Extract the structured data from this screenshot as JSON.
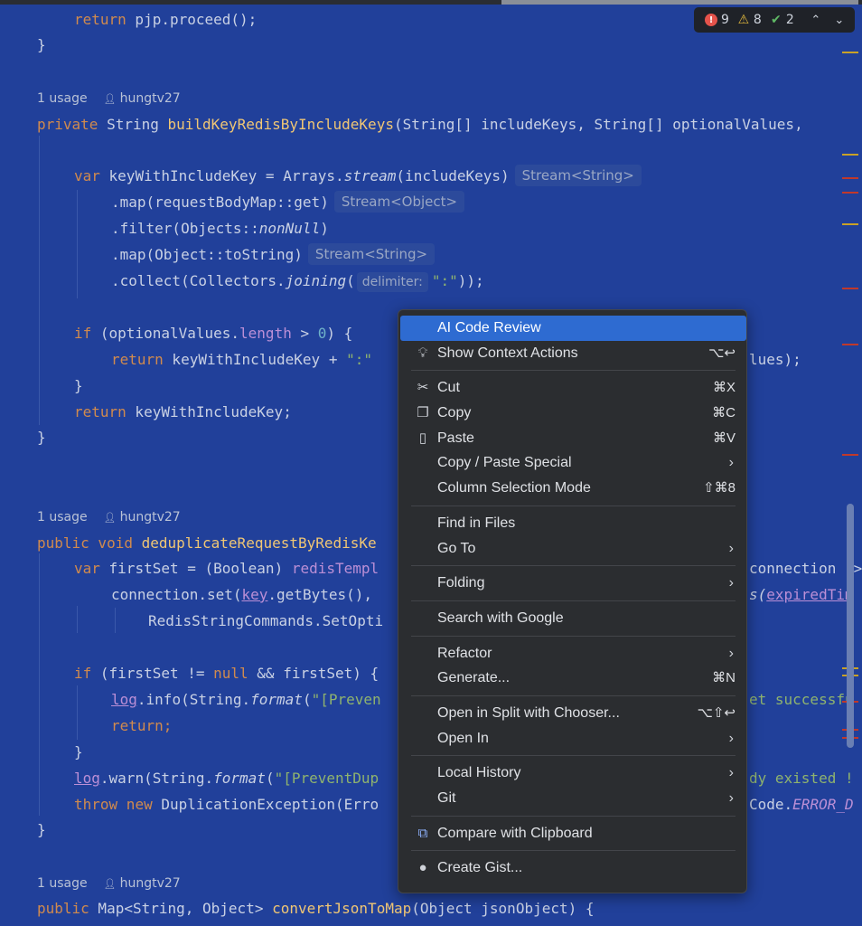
{
  "editor": {
    "lines": {
      "l_return_proceed_kw": "return",
      "l_return_proceed_rest": " pjp.proceed();",
      "close_brace": "}",
      "meta1_usage": "1 usage",
      "meta1_author": "hungtv27",
      "sig1_private": "private",
      "sig1_type": " String ",
      "sig1_name": "buildKeyRedisByIncludeKeys",
      "sig1_params": "(String[] includeKeys, String[] optionalValues, ",
      "var_kw": "var",
      "var_line_rest": " keyWithIncludeKey = Arrays.",
      "var_stream": "stream",
      "var_args": "(includeKeys)",
      "hint_stream_string": "Stream<String>",
      "map_get": ".map(requestBodyMap::get)",
      "hint_stream_object": "Stream<Object>",
      "filter_a": ".filter(Objects::",
      "filter_b": "nonNull",
      "filter_c": ")",
      "map_tostring": ".map(Object::toString)",
      "collect_a": ".collect(Collectors.",
      "collect_b": "joining",
      "collect_c": "(",
      "hint_delimiter": "delimiter:",
      "collect_str": "\":\"",
      "collect_end": "));",
      "if_kw": "if",
      "if_a": " (optionalValues.",
      "if_len": "length",
      "if_b": " > ",
      "if_num": "0",
      "if_c": ") {",
      "ret_kw": "return",
      "ret_a": " keyWithIncludeKey + ",
      "ret_str": "\":\"",
      "ret_tail": "lues);",
      "return_kw2": "return",
      "return_key": " keyWithIncludeKey;",
      "meta2_usage": "1 usage",
      "meta2_author": "hungtv27",
      "sig2_public": "public",
      "sig2_void": " void ",
      "sig2_name": "deduplicateRequestByRedisKe",
      "fs_var": "var",
      "fs_a": " firstSet = (Boolean) ",
      "fs_field": "redisTempl",
      "fs_tail": "connection ->",
      "cs_a": "connection.set(",
      "cs_key": "key",
      "cs_b": ".getBytes(),",
      "cs_tail_a": "s(",
      "cs_tail_b": "expiredTim",
      "rsc": "RedisStringCommands.SetOpti",
      "if2_kw": "if",
      "if2_a": " (firstSet != ",
      "if2_null": "null",
      "if2_b": " && firstSet) {",
      "log_info_a": "log",
      "log_info_b": ".info(String.",
      "log_info_c": "format",
      "log_info_d": "(",
      "log_info_str": "\"[Preven",
      "log_info_tail": "et successfu",
      "return_semicolon": "return;",
      "log_warn_a": "log",
      "log_warn_b": ".warn(String.",
      "log_warn_c": "format",
      "log_warn_d": "(",
      "log_warn_str": "\"[PreventDup",
      "log_warn_tail": "dy existed !",
      "throw_kw": "throw",
      "new_kw": " new",
      "throw_rest": " DuplicationException(Erro",
      "throw_tail_a": "Code.",
      "throw_tail_b": "ERROR_D",
      "meta3_usage": "1 usage",
      "meta3_author": "hungtv27",
      "sig3_public": "public",
      "sig3_rest": " Map<String, Object> ",
      "sig3_name": "convertJsonToMap",
      "sig3_params": "(Object jsonObject) {"
    }
  },
  "inspection": {
    "errors": "9",
    "warnings": "8",
    "weak_warnings": "2",
    "error_icon": "error-circle-icon",
    "warning_icon": "warning-triangle-icon",
    "check_icon": "double-check-icon"
  },
  "context_menu": {
    "items": [
      {
        "label": "AI Code Review",
        "shortcut": "",
        "icon": "",
        "submenu": false,
        "selected": true
      },
      {
        "label": "Show Context Actions",
        "shortcut": "⌥↩",
        "icon": "lightbulb-icon",
        "submenu": false
      },
      {
        "label": "Cut",
        "shortcut": "⌘X",
        "icon": "scissors-icon",
        "submenu": false
      },
      {
        "label": "Copy",
        "shortcut": "⌘C",
        "icon": "copy-icon",
        "submenu": false
      },
      {
        "label": "Paste",
        "shortcut": "⌘V",
        "icon": "clipboard-icon",
        "submenu": false
      },
      {
        "label": "Copy / Paste Special",
        "shortcut": "",
        "icon": "",
        "submenu": true
      },
      {
        "label": "Column Selection Mode",
        "shortcut": "⇧⌘8",
        "icon": "",
        "submenu": false
      },
      {
        "label": "Find in Files",
        "shortcut": "",
        "icon": "",
        "submenu": false
      },
      {
        "label": "Go To",
        "shortcut": "",
        "icon": "",
        "submenu": true
      },
      {
        "label": "Folding",
        "shortcut": "",
        "icon": "",
        "submenu": true
      },
      {
        "label": "Search with Google",
        "shortcut": "",
        "icon": "",
        "submenu": false
      },
      {
        "label": "Refactor",
        "shortcut": "",
        "icon": "",
        "submenu": true
      },
      {
        "label": "Generate...",
        "shortcut": "⌘N",
        "icon": "",
        "submenu": false
      },
      {
        "label": "Open in Split with Chooser...",
        "shortcut": "⌥⇧↩",
        "icon": "",
        "submenu": false
      },
      {
        "label": "Open In",
        "shortcut": "",
        "icon": "",
        "submenu": true
      },
      {
        "label": "Local History",
        "shortcut": "",
        "icon": "",
        "submenu": true
      },
      {
        "label": "Git",
        "shortcut": "",
        "icon": "",
        "submenu": true
      },
      {
        "label": "Compare with Clipboard",
        "shortcut": "",
        "icon": "compare-clipboard-icon",
        "submenu": false
      },
      {
        "label": "Create Gist...",
        "shortcut": "",
        "icon": "github-icon",
        "submenu": false
      }
    ],
    "submenu_arrow": "›"
  },
  "colors": {
    "editor_bg": "#21409a",
    "menu_bg": "#2b2d30",
    "menu_selected": "#2e6bd1",
    "keyword": "#d08a4e",
    "function": "#f0c674"
  }
}
